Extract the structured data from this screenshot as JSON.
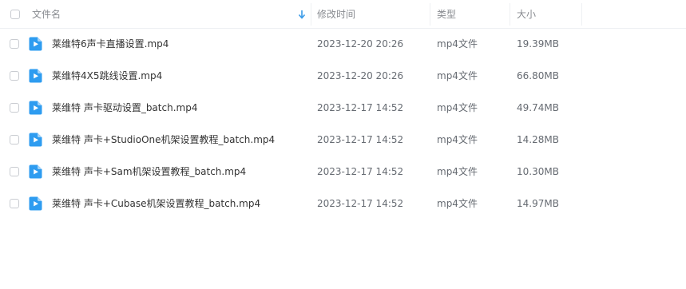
{
  "header": {
    "name": "文件名",
    "modified": "修改时间",
    "type": "类型",
    "size": "大小"
  },
  "icons": {
    "sort": "sort-down-arrow-icon",
    "file": "video-file-icon"
  },
  "colors": {
    "accent": "#3a9be8",
    "file_icon": "#2e9cf0"
  },
  "files": [
    {
      "name": "莱维特6声卡直播设置.mp4",
      "modified": "2023-12-20 20:26",
      "type": "mp4文件",
      "size": "19.39MB"
    },
    {
      "name": "莱维特4X5跳线设置.mp4",
      "modified": "2023-12-20 20:26",
      "type": "mp4文件",
      "size": "66.80MB"
    },
    {
      "name": "莱维特 声卡驱动设置_batch.mp4",
      "modified": "2023-12-17 14:52",
      "type": "mp4文件",
      "size": "49.74MB"
    },
    {
      "name": "莱维特 声卡+StudioOne机架设置教程_batch.mp4",
      "modified": "2023-12-17 14:52",
      "type": "mp4文件",
      "size": "14.28MB"
    },
    {
      "name": "莱维特 声卡+Sam机架设置教程_batch.mp4",
      "modified": "2023-12-17 14:52",
      "type": "mp4文件",
      "size": "10.30MB"
    },
    {
      "name": "莱维特 声卡+Cubase机架设置教程_batch.mp4",
      "modified": "2023-12-17 14:52",
      "type": "mp4文件",
      "size": "14.97MB"
    }
  ]
}
